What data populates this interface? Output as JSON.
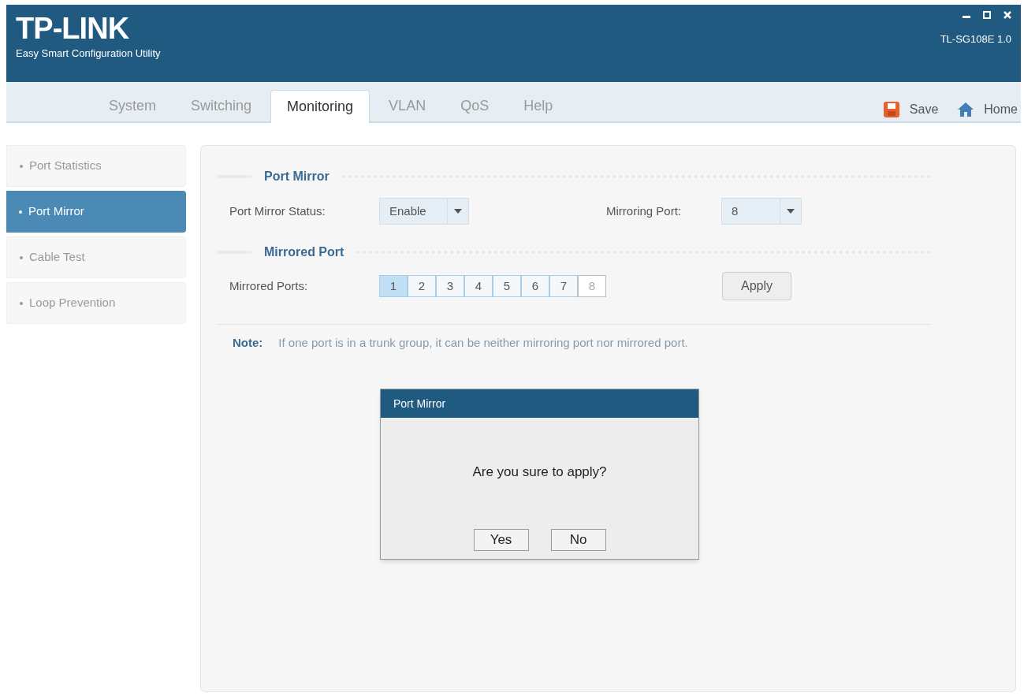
{
  "header": {
    "logo": "TP-LINK",
    "subtitle": "Easy Smart Configuration Utility",
    "model": "TL-SG108E 1.0"
  },
  "tabs": [
    {
      "label": "System",
      "selected": false
    },
    {
      "label": "Switching",
      "selected": false
    },
    {
      "label": "Monitoring",
      "selected": true
    },
    {
      "label": "VLAN",
      "selected": false
    },
    {
      "label": "QoS",
      "selected": false
    },
    {
      "label": "Help",
      "selected": false
    }
  ],
  "toolbar": [
    {
      "kind": "save",
      "label": "Save"
    },
    {
      "kind": "home",
      "label": "Home"
    }
  ],
  "sidebar": {
    "items": [
      {
        "label": "Port Statistics",
        "selected": false
      },
      {
        "label": "Port Mirror",
        "selected": true
      },
      {
        "label": "Cable Test",
        "selected": false
      },
      {
        "label": "Loop Prevention",
        "selected": false
      }
    ]
  },
  "port_mirror": {
    "heading": "Port Mirror",
    "status_label": "Port Mirror Status:",
    "status_value": "Enable",
    "mirroring_label": "Mirroring Port:",
    "mirroring_value": "8"
  },
  "mirrored_port": {
    "heading": "Mirrored Port",
    "label": "Mirrored Ports:",
    "ports": [
      {
        "label": "1",
        "selected": true,
        "disabled": false
      },
      {
        "label": "2",
        "selected": false,
        "disabled": false
      },
      {
        "label": "3",
        "selected": false,
        "disabled": false
      },
      {
        "label": "4",
        "selected": false,
        "disabled": false
      },
      {
        "label": "5",
        "selected": false,
        "disabled": false
      },
      {
        "label": "6",
        "selected": false,
        "disabled": false
      },
      {
        "label": "7",
        "selected": false,
        "disabled": false
      },
      {
        "label": "8",
        "selected": false,
        "disabled": true
      }
    ],
    "apply": "Apply"
  },
  "note": {
    "label": "Note:",
    "text": "If one port is in a trunk group, it can be neither mirroring port nor mirrored port."
  },
  "dialog": {
    "title": "Port Mirror",
    "message": "Are you sure to apply?",
    "buttons": [
      "Yes",
      "No"
    ]
  }
}
